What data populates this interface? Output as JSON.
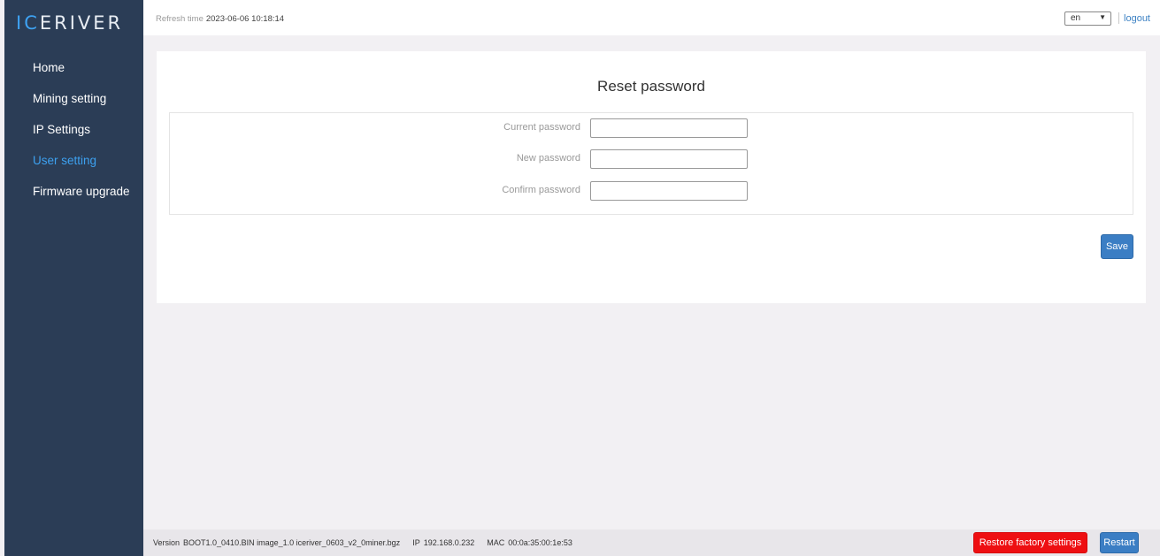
{
  "brand": {
    "logo_part1": "IC",
    "logo_part2": "ERIVER"
  },
  "sidebar": {
    "items": [
      {
        "label": "Home",
        "active": false
      },
      {
        "label": "Mining setting",
        "active": false
      },
      {
        "label": "IP Settings",
        "active": false
      },
      {
        "label": "User setting",
        "active": true
      },
      {
        "label": "Firmware upgrade",
        "active": false
      }
    ]
  },
  "header": {
    "refresh_label": "Refresh time",
    "refresh_time": "2023-06-06 10:18:14",
    "language": "en",
    "logout_label": "logout"
  },
  "form": {
    "title": "Reset password",
    "fields": [
      {
        "label": "Current password",
        "value": ""
      },
      {
        "label": "New password",
        "value": ""
      },
      {
        "label": "Confirm password",
        "value": ""
      }
    ],
    "save_label": "Save"
  },
  "footer": {
    "version_label": "Version",
    "version_value": "BOOT1.0_0410.BIN image_1.0 iceriver_0603_v2_0miner.bgz",
    "ip_label": "IP",
    "ip_value": "192.168.0.232",
    "mac_label": "MAC",
    "mac_value": "00:0a:35:00:1e:53",
    "restore_label": "Restore factory settings",
    "restart_label": "Restart"
  },
  "colors": {
    "sidebar_bg": "#2b3d56",
    "accent": "#3da1f0",
    "primary_button": "#3b7ec4",
    "danger_button": "#ee0f12"
  }
}
